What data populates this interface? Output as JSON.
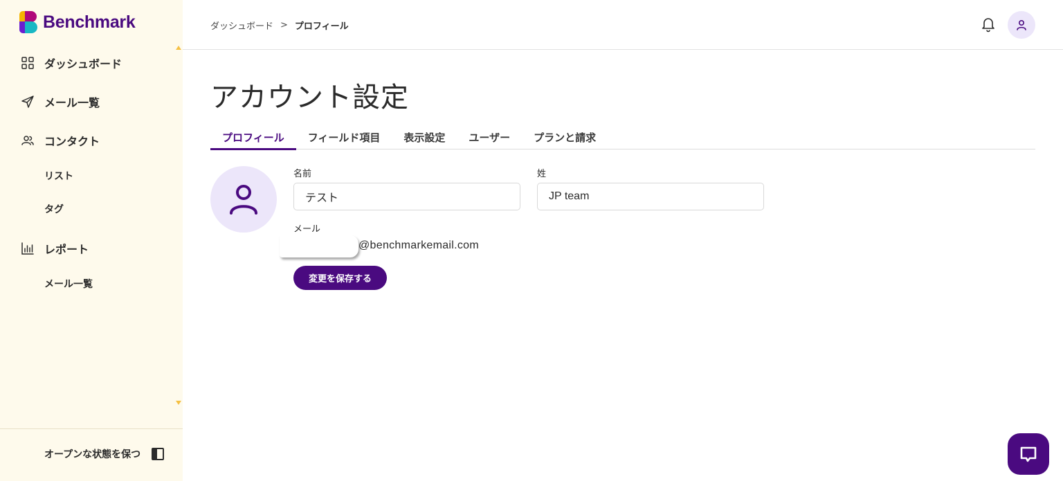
{
  "brand": {
    "name": "Benchmark"
  },
  "sidebar": {
    "items": [
      {
        "label": "ダッシュボード",
        "icon": "grid-icon"
      },
      {
        "label": "メール一覧",
        "icon": "send-icon"
      },
      {
        "label": "コンタクト",
        "icon": "users-icon"
      },
      {
        "label": "リスト"
      },
      {
        "label": "タグ"
      },
      {
        "label": "レポート",
        "icon": "bar-chart-icon"
      },
      {
        "label": "メール一覧"
      }
    ],
    "keep_open_label": "オープンな状態を保つ"
  },
  "header": {
    "breadcrumb": {
      "parent": "ダッシュボード",
      "separator": ">",
      "current": "プロフィール"
    }
  },
  "main": {
    "title": "アカウント設定",
    "tabs": [
      {
        "label": "プロフィール",
        "active": true
      },
      {
        "label": "フィールド項目"
      },
      {
        "label": "表示設定"
      },
      {
        "label": "ユーザー"
      },
      {
        "label": "プランと請求"
      }
    ],
    "form": {
      "first_name_label": "名前",
      "first_name_value": "テスト",
      "last_name_label": "姓",
      "last_name_value": "JP team",
      "email_label": "メール",
      "email_domain": "@benchmarkemail.com",
      "save_label": "変更を保存する"
    }
  },
  "colors": {
    "primary": "#4a0a80",
    "sidebar_bg": "#fefaec",
    "avatar_bg": "#ece6fa"
  }
}
